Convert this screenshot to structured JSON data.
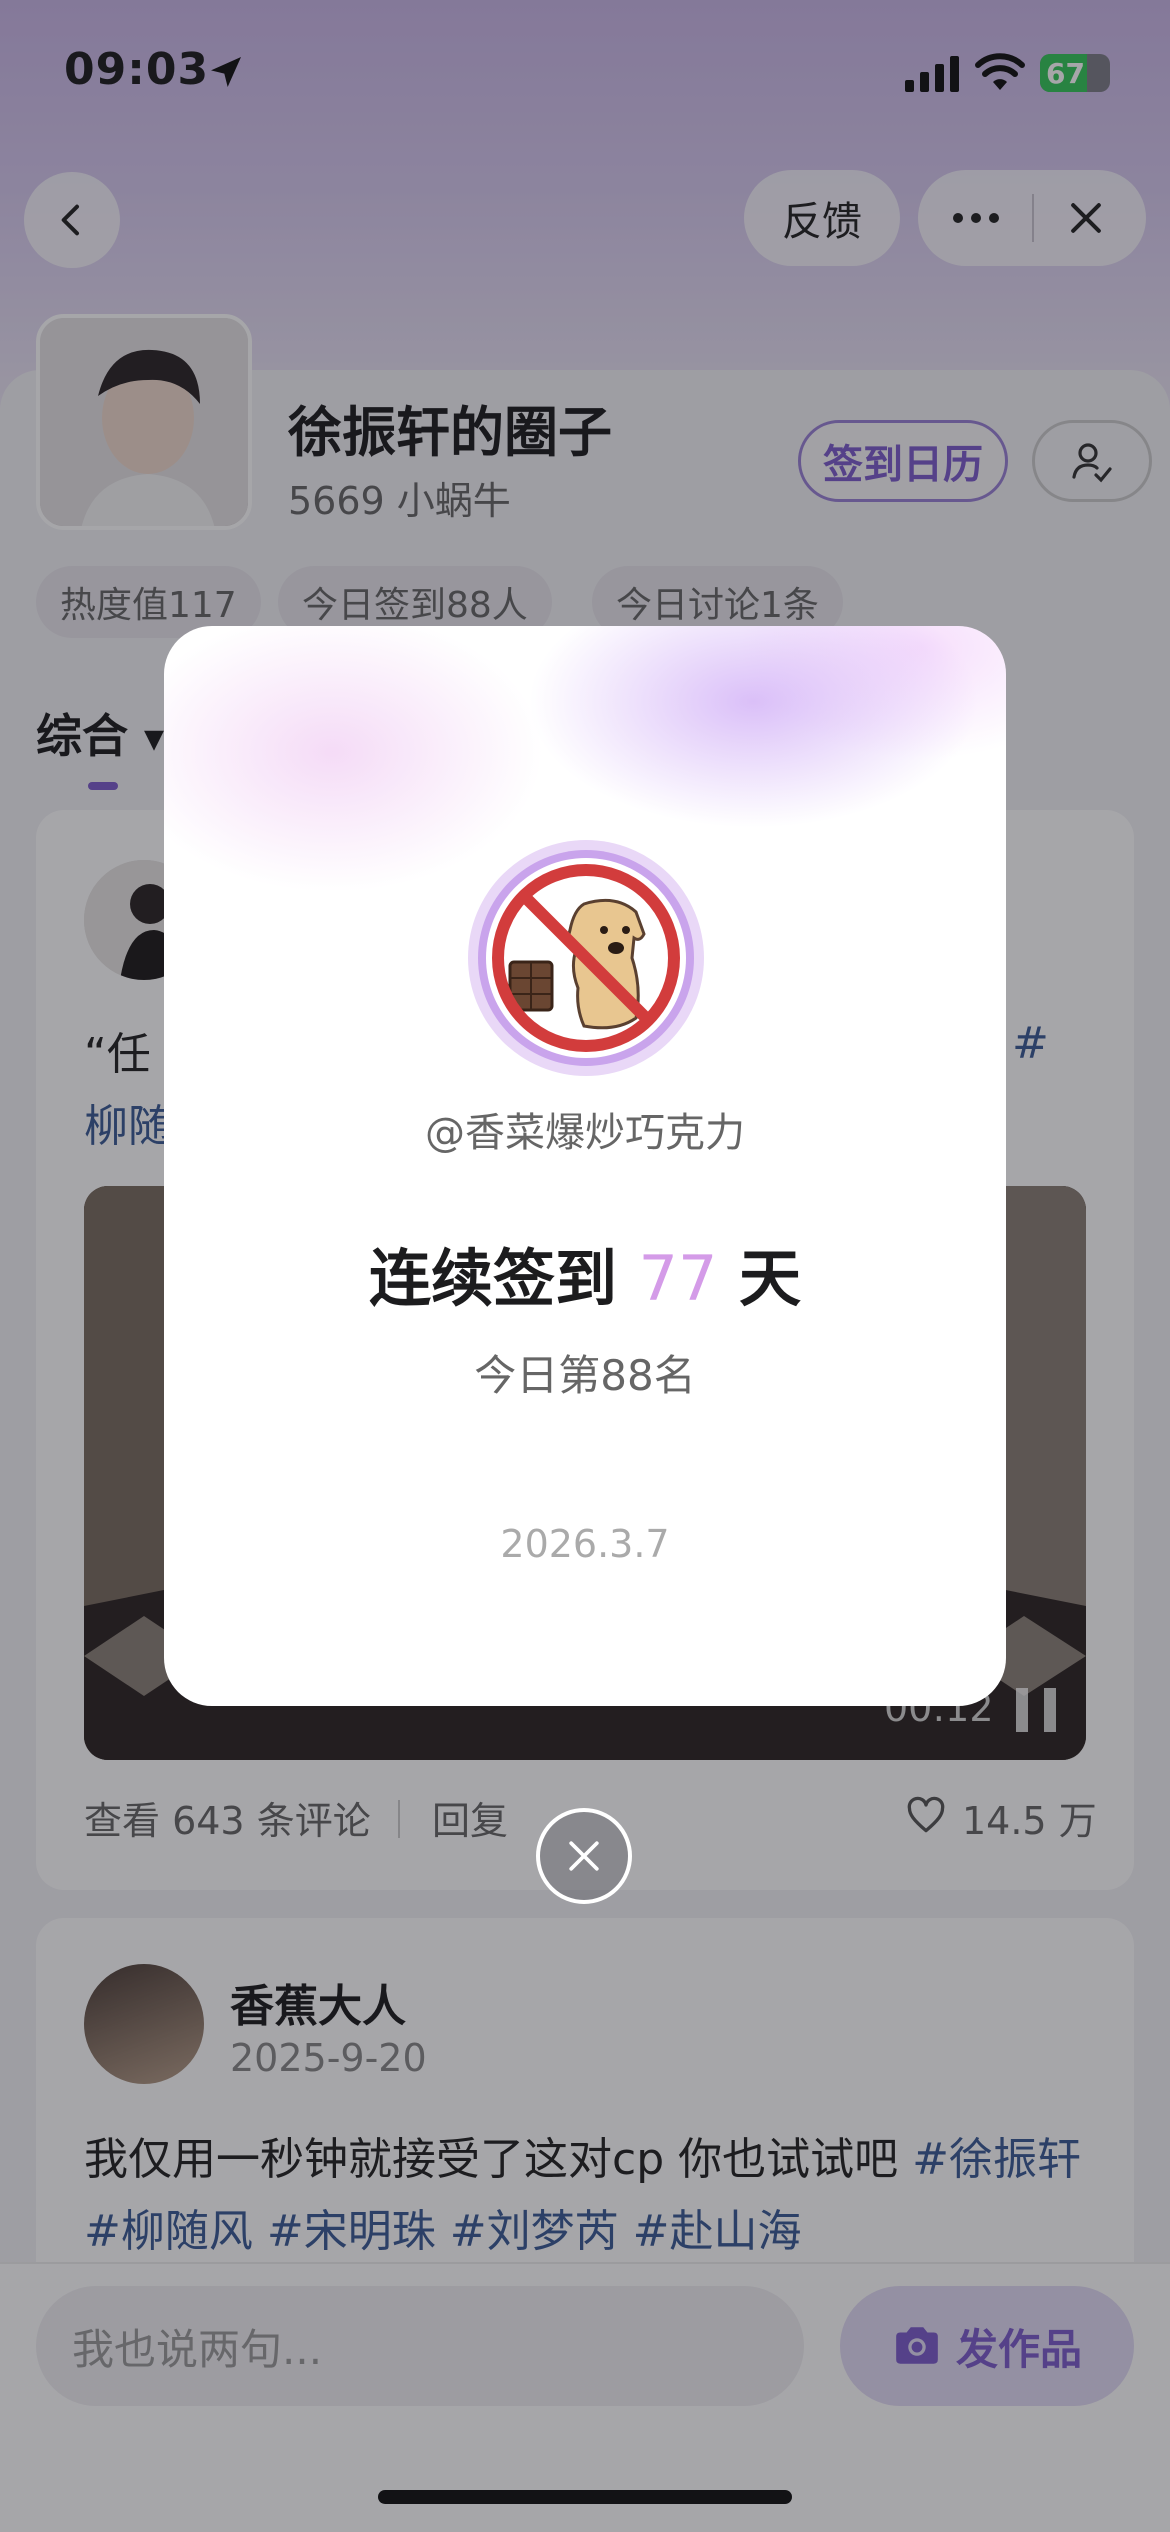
{
  "status_bar": {
    "time": "09:03",
    "battery": "67"
  },
  "nav": {
    "feedback_label": "反馈"
  },
  "circle": {
    "name": "徐振轩的圈子",
    "members": "5669 小蜗牛",
    "checkin_calendar_label": "签到日历",
    "stats": [
      "热度值117",
      "今日签到88人",
      "今日讨论1条"
    ]
  },
  "tabs": {
    "active": "综合"
  },
  "post1": {
    "text_start": "“任",
    "tag_start": "柳随",
    "tag_end": "#",
    "video_time": "00:12",
    "comments_label": "查看 643 条评论",
    "reply_label": "回复",
    "likes": "14.5 万"
  },
  "post2": {
    "author": "香蕉大人",
    "date": "2025-9-20",
    "text": "我仅用一秒钟就接受了这对cp 你也试试吧 ",
    "tags": [
      "#徐振轩",
      "#柳随风",
      "#宋明珠",
      "#刘梦芮",
      "#赴山海"
    ]
  },
  "bottom": {
    "input_placeholder": "我也说两句...",
    "post_button_label": "发作品"
  },
  "modal": {
    "handle": "@香菜爆炒巧克力",
    "streak_prefix": "连续签到 ",
    "streak_days": "77",
    "streak_suffix": " 天",
    "rank": "今日第88名",
    "date": "2026.3.7"
  },
  "colors": {
    "accent": "#7c5ccb",
    "streak_number": "#d49be8",
    "hashtag": "#3b5b95"
  }
}
